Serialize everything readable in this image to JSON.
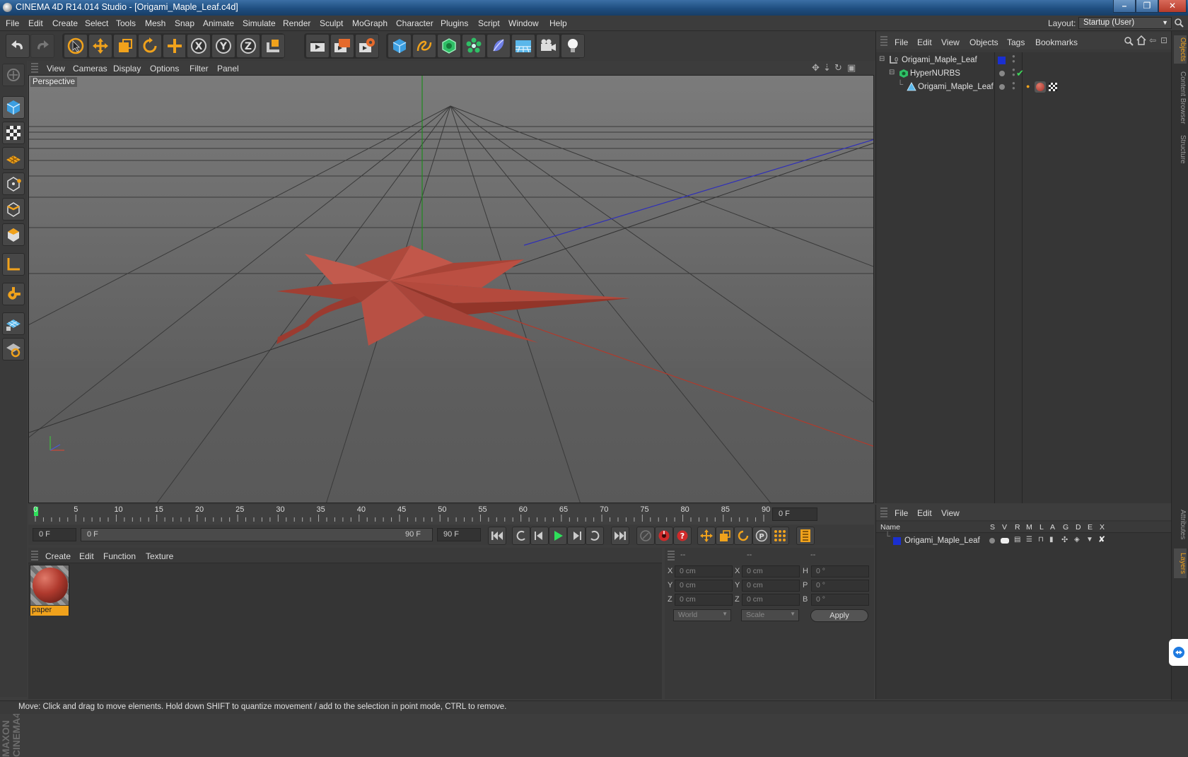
{
  "window": {
    "title": "CINEMA 4D R14.014 Studio - [Origami_Maple_Leaf.c4d]",
    "minimize": "–",
    "restore": "❐",
    "close": "✕"
  },
  "menu": [
    "File",
    "Edit",
    "Create",
    "Select",
    "Tools",
    "Mesh",
    "Snap",
    "Animate",
    "Simulate",
    "Render",
    "Sculpt",
    "MoGraph",
    "Character",
    "Plugins",
    "Script",
    "Window",
    "Help"
  ],
  "layout": {
    "label": "Layout:",
    "value": "Startup (User)"
  },
  "toolbar": {
    "tools": [
      "undo-icon",
      "redo-icon",
      "live-selection-icon",
      "move-icon",
      "scale-icon",
      "rotate-icon",
      "add-object-icon",
      "x-axis-icon",
      "y-axis-icon",
      "z-axis-icon",
      "world-coordinates-icon",
      "render-view-icon",
      "render-picture-viewer-icon",
      "render-settings-icon",
      "cube-icon",
      "spline-icon",
      "nurbs-icon",
      "array-icon",
      "deformer-icon",
      "environment-icon",
      "camera-icon",
      "light-icon"
    ],
    "axis_labels": {
      "x": "X",
      "y": "Y",
      "z": "Z"
    }
  },
  "left_tools": [
    "make-editable-icon",
    "model-mode-icon",
    "texture-mode-icon",
    "workplane-icon",
    "point-mode-icon",
    "edge-mode-icon",
    "polygon-mode-icon",
    "axis-mode-icon",
    "magnet-icon",
    "snap-grid-icon",
    "snap-rotate-icon"
  ],
  "branding": "MAXON CINEMA4D",
  "viewport": {
    "menu": [
      "View",
      "Cameras",
      "Display",
      "Options",
      "Filter",
      "Panel"
    ],
    "label": "Perspective",
    "model_color": "#b34a3e"
  },
  "timeline": {
    "ticks": [
      "0",
      "5",
      "10",
      "15",
      "20",
      "25",
      "30",
      "35",
      "40",
      "45",
      "50",
      "55",
      "60",
      "65",
      "70",
      "75",
      "80",
      "85",
      "90"
    ],
    "end_field": "0 F"
  },
  "transport": {
    "current_frame": "0 F",
    "range_start": "0 F",
    "range_end": "90 F",
    "max_frame": "90 F"
  },
  "material_manager": {
    "menu": [
      "Create",
      "Edit",
      "Function",
      "Texture"
    ],
    "materials": [
      {
        "name": "paper"
      }
    ]
  },
  "coordinates": {
    "headers": [
      "--",
      "--",
      "--"
    ],
    "rows": [
      {
        "a": "X",
        "a_val": "0 cm",
        "b": "X",
        "b_val": "0 cm",
        "c": "H",
        "c_val": "0 °"
      },
      {
        "a": "Y",
        "a_val": "0 cm",
        "b": "Y",
        "b_val": "0 cm",
        "c": "P",
        "c_val": "0 °"
      },
      {
        "a": "Z",
        "a_val": "0 cm",
        "b": "Z",
        "b_val": "0 cm",
        "c": "B",
        "c_val": "0 °"
      }
    ],
    "mode": "World",
    "scale": "Scale",
    "apply": "Apply"
  },
  "status": "Move: Click and drag to move elements. Hold down SHIFT to quantize movement / add to the selection in point mode, CTRL to remove.",
  "object_manager": {
    "menu": [
      "File",
      "Edit",
      "View",
      "Objects",
      "Tags",
      "Bookmarks"
    ],
    "objects": [
      {
        "name": "Origami_Maple_Leaf"
      },
      {
        "name": "HyperNURBS"
      },
      {
        "name": "Origami_Maple_Leaf"
      }
    ]
  },
  "layer_manager": {
    "menu": [
      "File",
      "Edit",
      "View"
    ],
    "columns": [
      "Name",
      "S",
      "V",
      "R",
      "M",
      "L",
      "A",
      "G",
      "D",
      "E",
      "X"
    ],
    "layers": [
      {
        "name": "Origami_Maple_Leaf",
        "color": "#1a2fd0"
      }
    ]
  },
  "side_tabs": [
    "Objects",
    "Content Browser",
    "Structure",
    "Attributes",
    "Layers"
  ]
}
